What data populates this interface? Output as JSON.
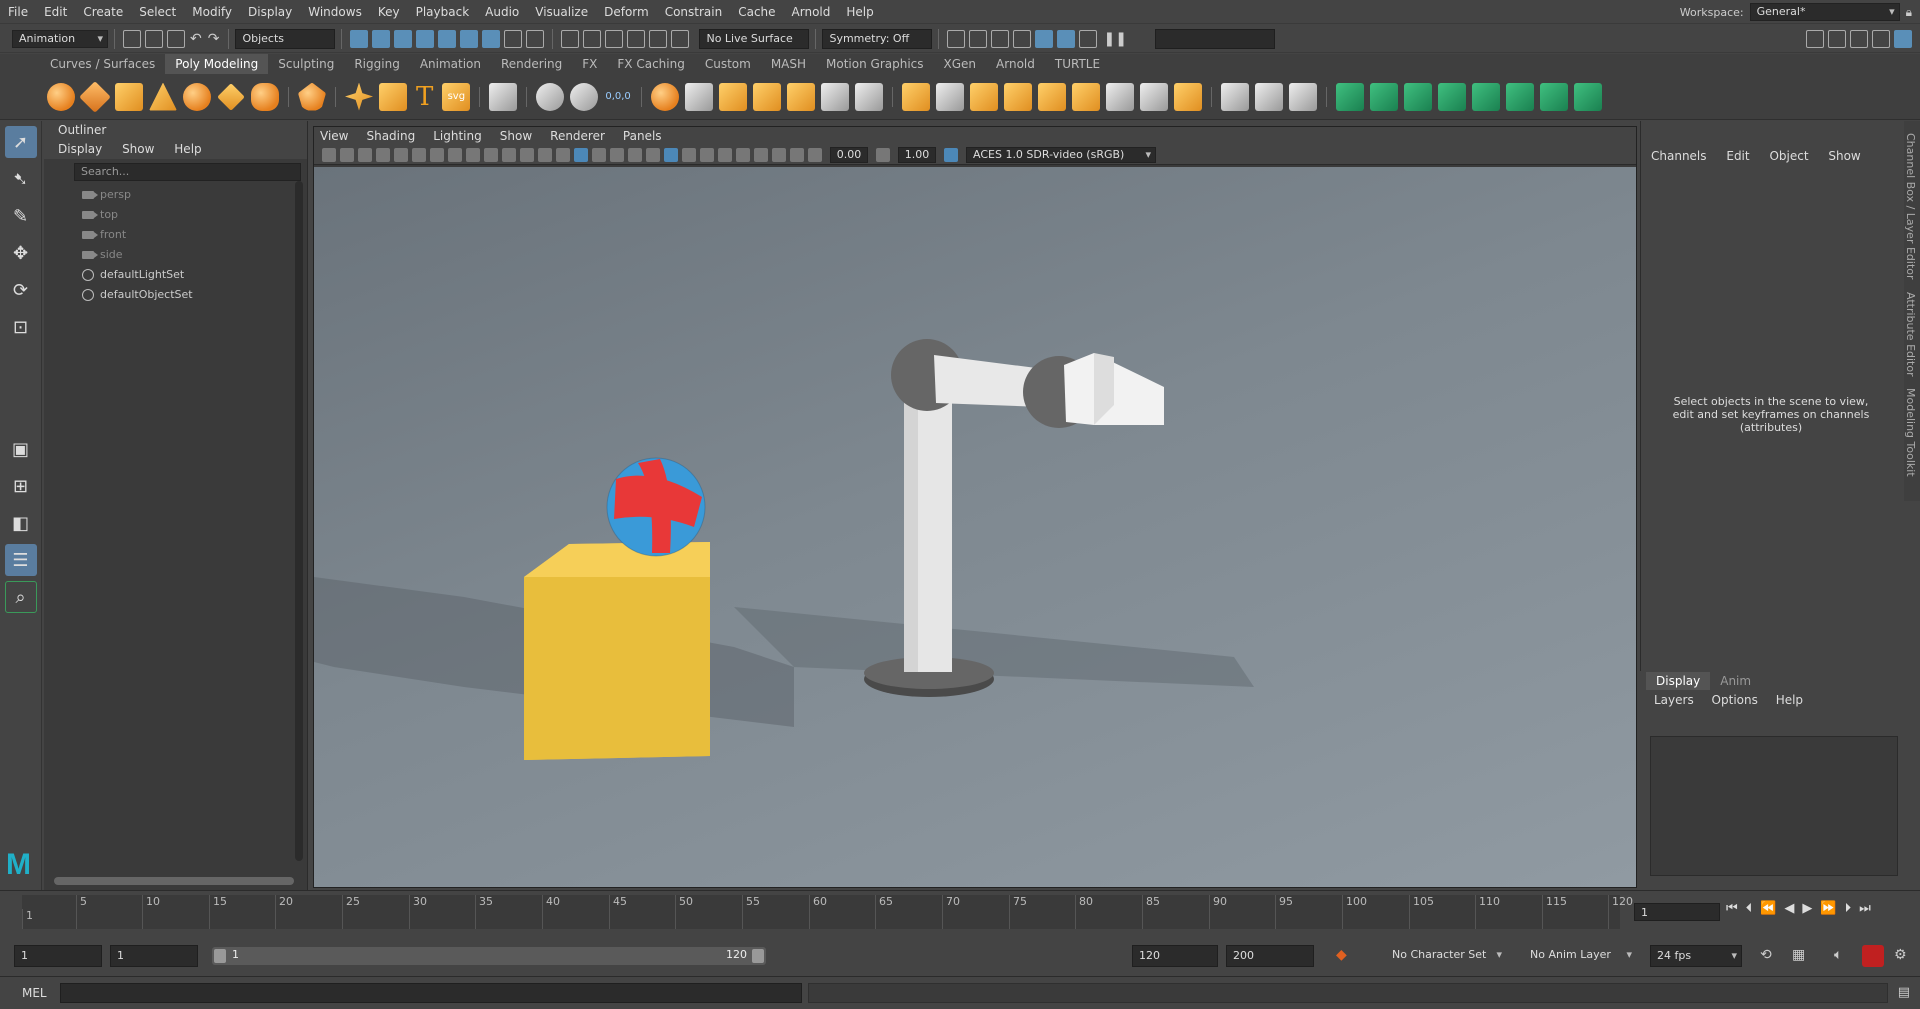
{
  "menubar": {
    "items": [
      "File",
      "Edit",
      "Create",
      "Select",
      "Modify",
      "Display",
      "Windows",
      "Key",
      "Playback",
      "Audio",
      "Visualize",
      "Deform",
      "Constrain",
      "Cache",
      "Arnold",
      "Help"
    ],
    "workspace_label": "Workspace:",
    "workspace_value": "General*"
  },
  "statusline": {
    "mode": "Animation",
    "selection_mode": "Objects",
    "live_surface": "No Live Surface",
    "symmetry": "Symmetry: Off"
  },
  "shelf": {
    "tabs": [
      "Curves / Surfaces",
      "Poly Modeling",
      "Sculpting",
      "Rigging",
      "Animation",
      "Rendering",
      "FX",
      "FX Caching",
      "Custom",
      "MASH",
      "Motion Graphics",
      "XGen",
      "Arnold",
      "TURTLE"
    ],
    "active_tab": "Poly Modeling",
    "svg_label": "svg",
    "coord_label": "0,0,0"
  },
  "outliner": {
    "title": "Outliner",
    "menu": [
      "Display",
      "Show",
      "Help"
    ],
    "search_placeholder": "Search...",
    "items": [
      {
        "label": "persp",
        "icon": "camera-icon"
      },
      {
        "label": "top",
        "icon": "camera-icon"
      },
      {
        "label": "front",
        "icon": "camera-icon"
      },
      {
        "label": "side",
        "icon": "camera-icon"
      },
      {
        "label": "defaultLightSet",
        "icon": "set-icon"
      },
      {
        "label": "defaultObjectSet",
        "icon": "set-icon"
      }
    ]
  },
  "viewport": {
    "menu": [
      "View",
      "Shading",
      "Lighting",
      "Show",
      "Renderer",
      "Panels"
    ],
    "exposure": "0.00",
    "gamma": "1.00",
    "color_space": "ACES 1.0 SDR-video (sRGB)"
  },
  "channelbox": {
    "menu": [
      "Channels",
      "Edit",
      "Object",
      "Show"
    ],
    "message": "Select objects in the scene to view, edit and set keyframes on channels (attributes)",
    "side_tabs": [
      "Channel Box / Layer Editor",
      "Attribute Editor",
      "Modeling Toolkit"
    ]
  },
  "layereditor": {
    "tabs": [
      "Display",
      "Anim"
    ],
    "active_tab": "Display",
    "menu": [
      "Layers",
      "Options",
      "Help"
    ]
  },
  "timeline": {
    "ticks": [
      "1",
      "5",
      "10",
      "15",
      "20",
      "25",
      "30",
      "35",
      "40",
      "45",
      "50",
      "55",
      "60",
      "65",
      "70",
      "75",
      "80",
      "85",
      "90",
      "95",
      "100",
      "105",
      "110",
      "115",
      "120"
    ],
    "current_frame": "1"
  },
  "range": {
    "start": "1",
    "playback_start": "1",
    "range_start": "1",
    "range_end": "120",
    "playback_end": "120",
    "end": "200",
    "character_set": "No Character Set",
    "anim_layer": "No Anim Layer",
    "fps": "24 fps"
  },
  "cmdline": {
    "label": "MEL"
  }
}
